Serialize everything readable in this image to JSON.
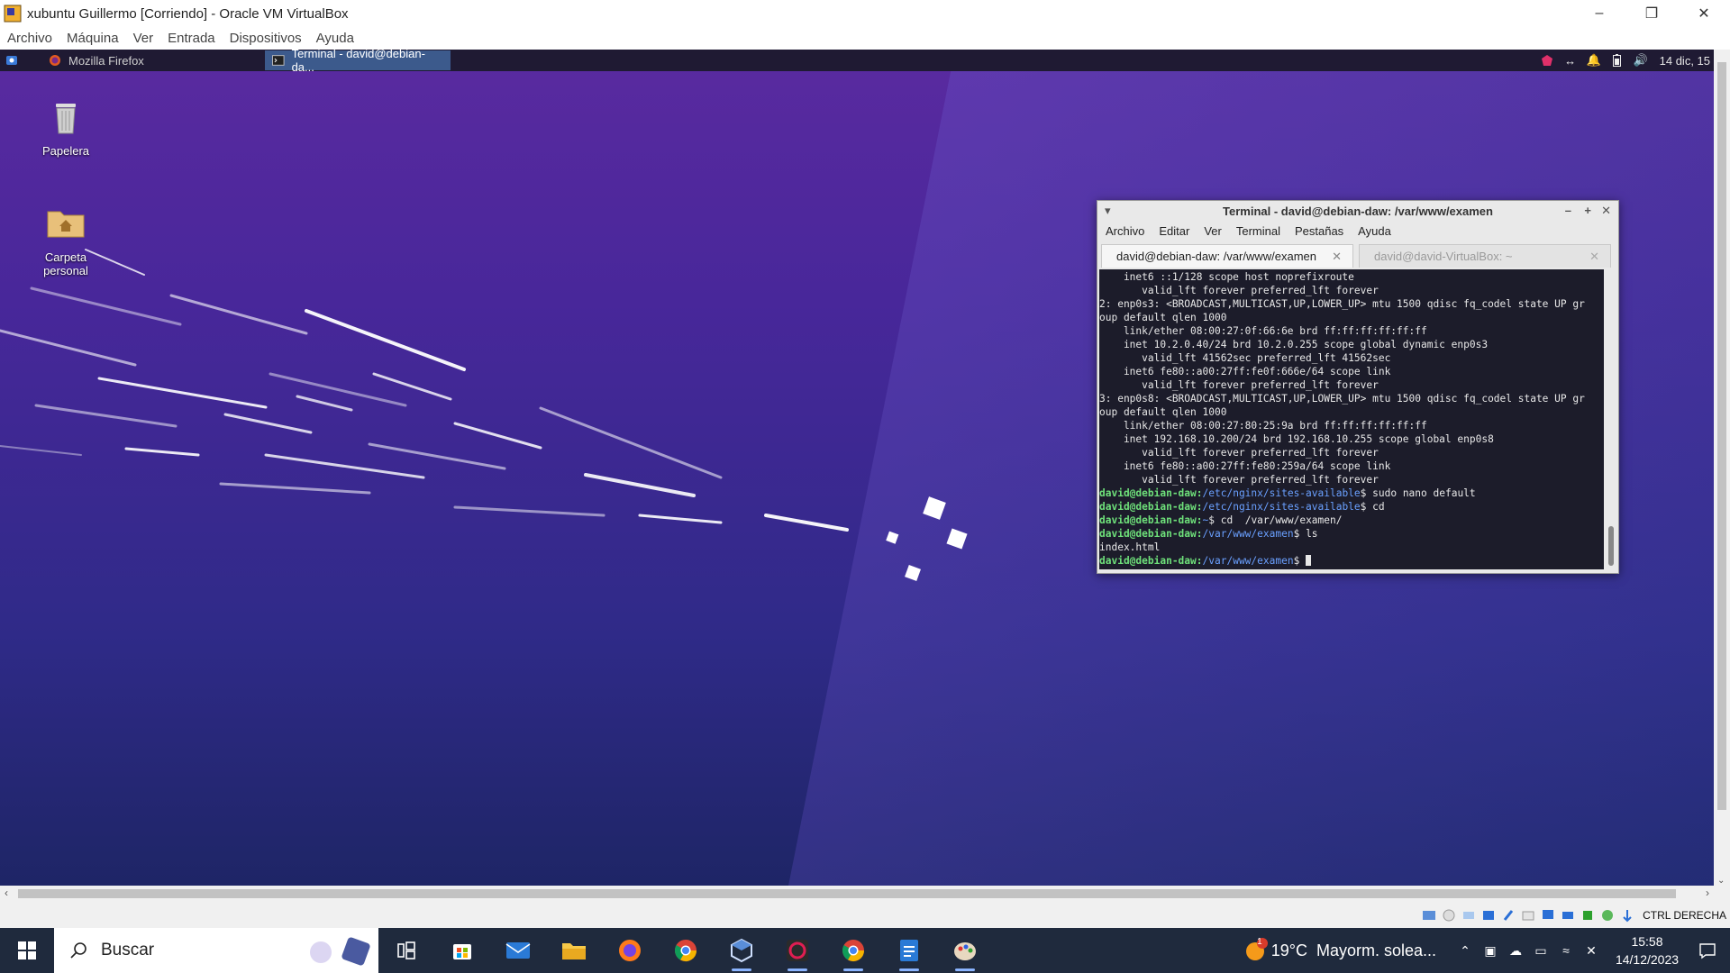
{
  "vbox": {
    "title": "xubuntu Guillermo [Corriendo] - Oracle VM VirtualBox",
    "menu": [
      "Archivo",
      "Máquina",
      "Ver",
      "Entrada",
      "Dispositivos",
      "Ayuda"
    ],
    "host_key": "CTRL DERECHA"
  },
  "guest": {
    "panel": {
      "tasks": [
        {
          "label": "Mozilla Firefox",
          "active": false
        },
        {
          "label": "Terminal - david@debian-da...",
          "active": true
        }
      ],
      "clock": "14 dic, 15"
    },
    "desktop_icons": [
      {
        "label": "Papelera"
      },
      {
        "label": "Carpeta personal"
      }
    ],
    "terminal": {
      "title": "Terminal - david@debian-daw: /var/www/examen",
      "menu": [
        "Archivo",
        "Editar",
        "Ver",
        "Terminal",
        "Pestañas",
        "Ayuda"
      ],
      "tabs": [
        {
          "label": "david@debian-daw: /var/www/examen",
          "active": true
        },
        {
          "label": "david@david-VirtualBox: ~",
          "active": false
        }
      ],
      "lines": [
        {
          "text": "    inet6 ::1/128 scope host noprefixroute"
        },
        {
          "text": "       valid_lft forever preferred_lft forever"
        },
        {
          "text": "2: enp0s3: <BROADCAST,MULTICAST,UP,LOWER_UP> mtu 1500 qdisc fq_codel state UP gr"
        },
        {
          "text": "oup default qlen 1000"
        },
        {
          "text": "    link/ether 08:00:27:0f:66:6e brd ff:ff:ff:ff:ff:ff"
        },
        {
          "text": "    inet 10.2.0.40/24 brd 10.2.0.255 scope global dynamic enp0s3"
        },
        {
          "text": "       valid_lft 41562sec preferred_lft 41562sec"
        },
        {
          "text": "    inet6 fe80::a00:27ff:fe0f:666e/64 scope link"
        },
        {
          "text": "       valid_lft forever preferred_lft forever"
        },
        {
          "text": "3: enp0s8: <BROADCAST,MULTICAST,UP,LOWER_UP> mtu 1500 qdisc fq_codel state UP gr"
        },
        {
          "text": "oup default qlen 1000"
        },
        {
          "text": "    link/ether 08:00:27:80:25:9a brd ff:ff:ff:ff:ff:ff"
        },
        {
          "text": "    inet 192.168.10.200/24 brd 192.168.10.255 scope global enp0s8"
        },
        {
          "text": "       valid_lft forever preferred_lft forever"
        },
        {
          "text": "    inet6 fe80::a00:27ff:fe80:259a/64 scope link"
        },
        {
          "text": "       valid_lft forever preferred_lft forever"
        },
        {
          "user": "david@debian-daw",
          "path": "/etc/nginx/sites-available",
          "cmd": " sudo nano default"
        },
        {
          "user": "david@debian-daw",
          "path": "/etc/nginx/sites-available",
          "cmd": " cd"
        },
        {
          "user": "david@debian-daw",
          "path": "~",
          "cmd": " cd  /var/www/examen/"
        },
        {
          "user": "david@debian-daw",
          "path": "/var/www/examen",
          "cmd": " ls"
        },
        {
          "text": "index.html"
        },
        {
          "user": "david@debian-daw",
          "path": "/var/www/examen",
          "cmd": " ",
          "cursor": true
        }
      ]
    }
  },
  "taskbar": {
    "search_label": "Buscar",
    "apps": [
      "task-view",
      "microsoft-store",
      "mail",
      "file-explorer",
      "firefox",
      "chrome",
      "virtualbox",
      "debian-app",
      "chrome",
      "docs-app",
      "paint-app"
    ],
    "weather": {
      "temp": "19°C",
      "desc": "Mayorm. solea...",
      "badge": "1"
    },
    "time": "15:58",
    "date": "14/12/2023"
  }
}
